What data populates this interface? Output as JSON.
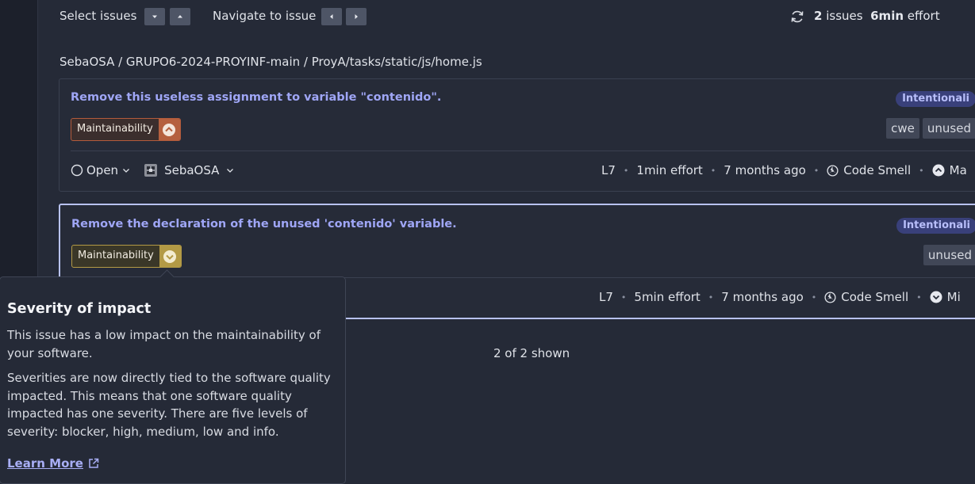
{
  "topbar": {
    "select_issues": "Select issues",
    "navigate_to_issue": "Navigate to issue",
    "issues_count": "2",
    "issues_label": "issues",
    "effort_value": "6min",
    "effort_label": "effort"
  },
  "breadcrumb": "SebaOSA / GRUPO6-2024-PROYINF-main / ProyA/tasks/static/js/home.js",
  "issues": [
    {
      "title": "Remove this useless assignment to variable \"contenido\".",
      "attribute": "Intentionali",
      "quality": "Maintainability",
      "severity_icon": "chevron-up-icon",
      "tags": [
        "cwe",
        "unused"
      ],
      "status": "Open",
      "assignee": "SebaOSA",
      "line": "L7",
      "effort": "1min effort",
      "age": "7 months ago",
      "type": "Code Smell",
      "severity_text": "Ma"
    },
    {
      "title": "Remove the declaration of the unused 'contenido' variable.",
      "attribute": "Intentionali",
      "quality": "Maintainability",
      "severity_icon": "chevron-down-icon",
      "tags": [
        "unused"
      ],
      "line": "L7",
      "effort": "5min effort",
      "age": "7 months ago",
      "type": "Code Smell",
      "severity_text": "Mi"
    }
  ],
  "shown": "2 of 2 shown",
  "popover": {
    "title": "Severity of impact",
    "p1": "This issue has a low impact on the maintainability of your software.",
    "p2": "Severities are now directly tied to the software quality impacted. This means that one software quality impacted has one severity. There are five levels of severity: blocker, high, medium, low and info.",
    "learn_more": "Learn More"
  },
  "colors": {
    "accent": "#9fa6f6",
    "high": "#b5603f",
    "low": "#b39a45",
    "background": "#252a37"
  }
}
